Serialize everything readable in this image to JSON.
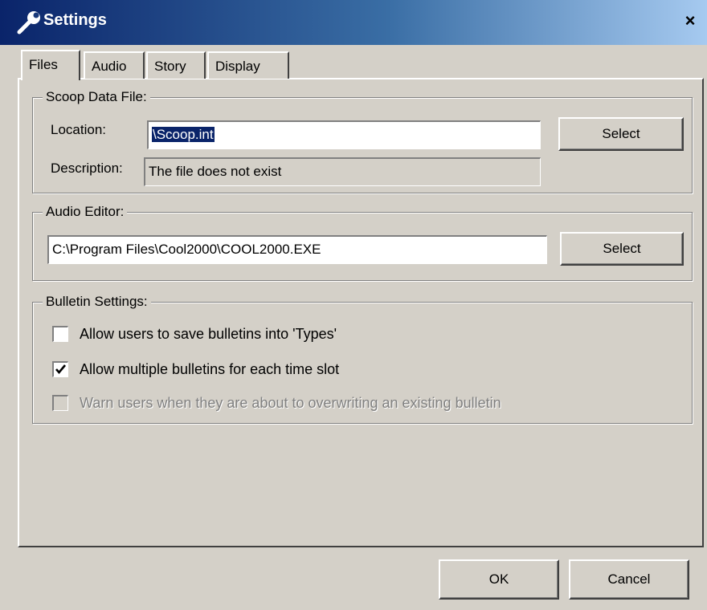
{
  "window": {
    "title": "Settings",
    "close_glyph": "×",
    "icon": "wrench-icon"
  },
  "tabs": [
    {
      "label": "Files",
      "active": true
    },
    {
      "label": "Audio",
      "active": false
    },
    {
      "label": "Story",
      "active": false
    },
    {
      "label": "Display",
      "active": false
    }
  ],
  "scoop_group": {
    "label": "Scoop Data File:",
    "location_label": "Location:",
    "location_value": "\\Scoop.int",
    "select_label": "Select",
    "description_label": "Description:",
    "description_value": "The file does not exist"
  },
  "audio_group": {
    "label": "Audio Editor:",
    "path_value": "C:\\Program Files\\Cool2000\\COOL2000.EXE",
    "select_label": "Select"
  },
  "bulletin_group": {
    "label": "Bulletin Settings:",
    "options": [
      {
        "label": "Allow users to save bulletins into 'Types'",
        "checked": false,
        "enabled": true
      },
      {
        "label": "Allow multiple bulletins for each time slot",
        "checked": true,
        "enabled": true
      },
      {
        "label": "Warn users when they are about to overwriting an existing bulletin",
        "checked": false,
        "enabled": false
      }
    ]
  },
  "footer": {
    "ok_label": "OK",
    "cancel_label": "Cancel"
  }
}
